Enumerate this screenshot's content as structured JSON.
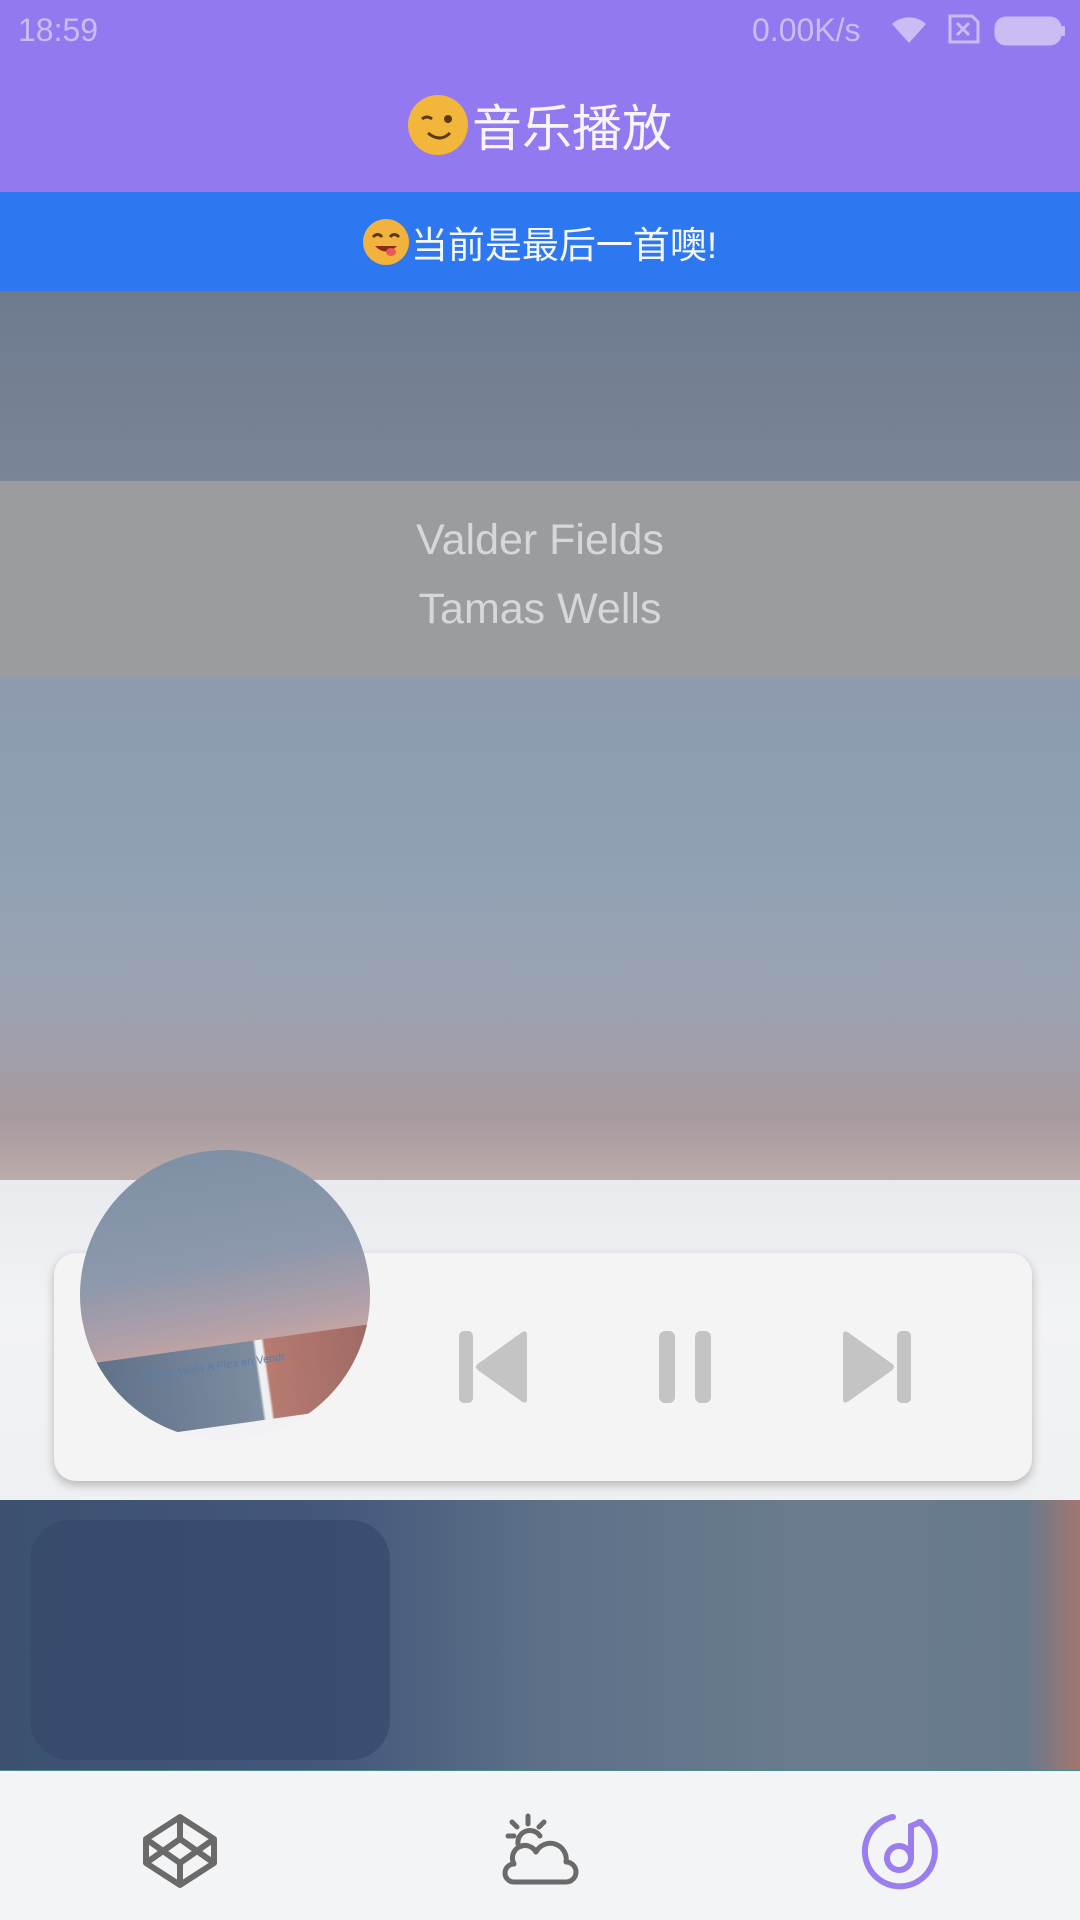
{
  "status_bar": {
    "time": "18:59",
    "net_speed": "0.00K/s",
    "icons": [
      "wifi-icon",
      "sim-off-icon",
      "battery-icon"
    ]
  },
  "header": {
    "emoji": "winking-face",
    "title": "音乐播放"
  },
  "notice": {
    "emoji": "face-savoring-food",
    "text": "当前是最后一首噢!"
  },
  "now_playing": {
    "title": "Valder Fields",
    "artist": "Tamas Wells",
    "album_art_caption": "Tamas Wells A Plea en Vendr"
  },
  "player": {
    "controls": [
      "previous-icon",
      "pause-icon",
      "next-icon"
    ]
  },
  "bottom_nav": {
    "items": [
      {
        "icon": "codepen-icon",
        "active": false
      },
      {
        "icon": "weather-icon",
        "active": false
      },
      {
        "icon": "music-icon",
        "active": true
      }
    ]
  },
  "colors": {
    "app_bar": "#9279ef",
    "notice_bar": "#2d78f0",
    "nav_active": "#9a7ef0",
    "nav_inactive": "#666666",
    "controls": "#c4c4c4"
  }
}
